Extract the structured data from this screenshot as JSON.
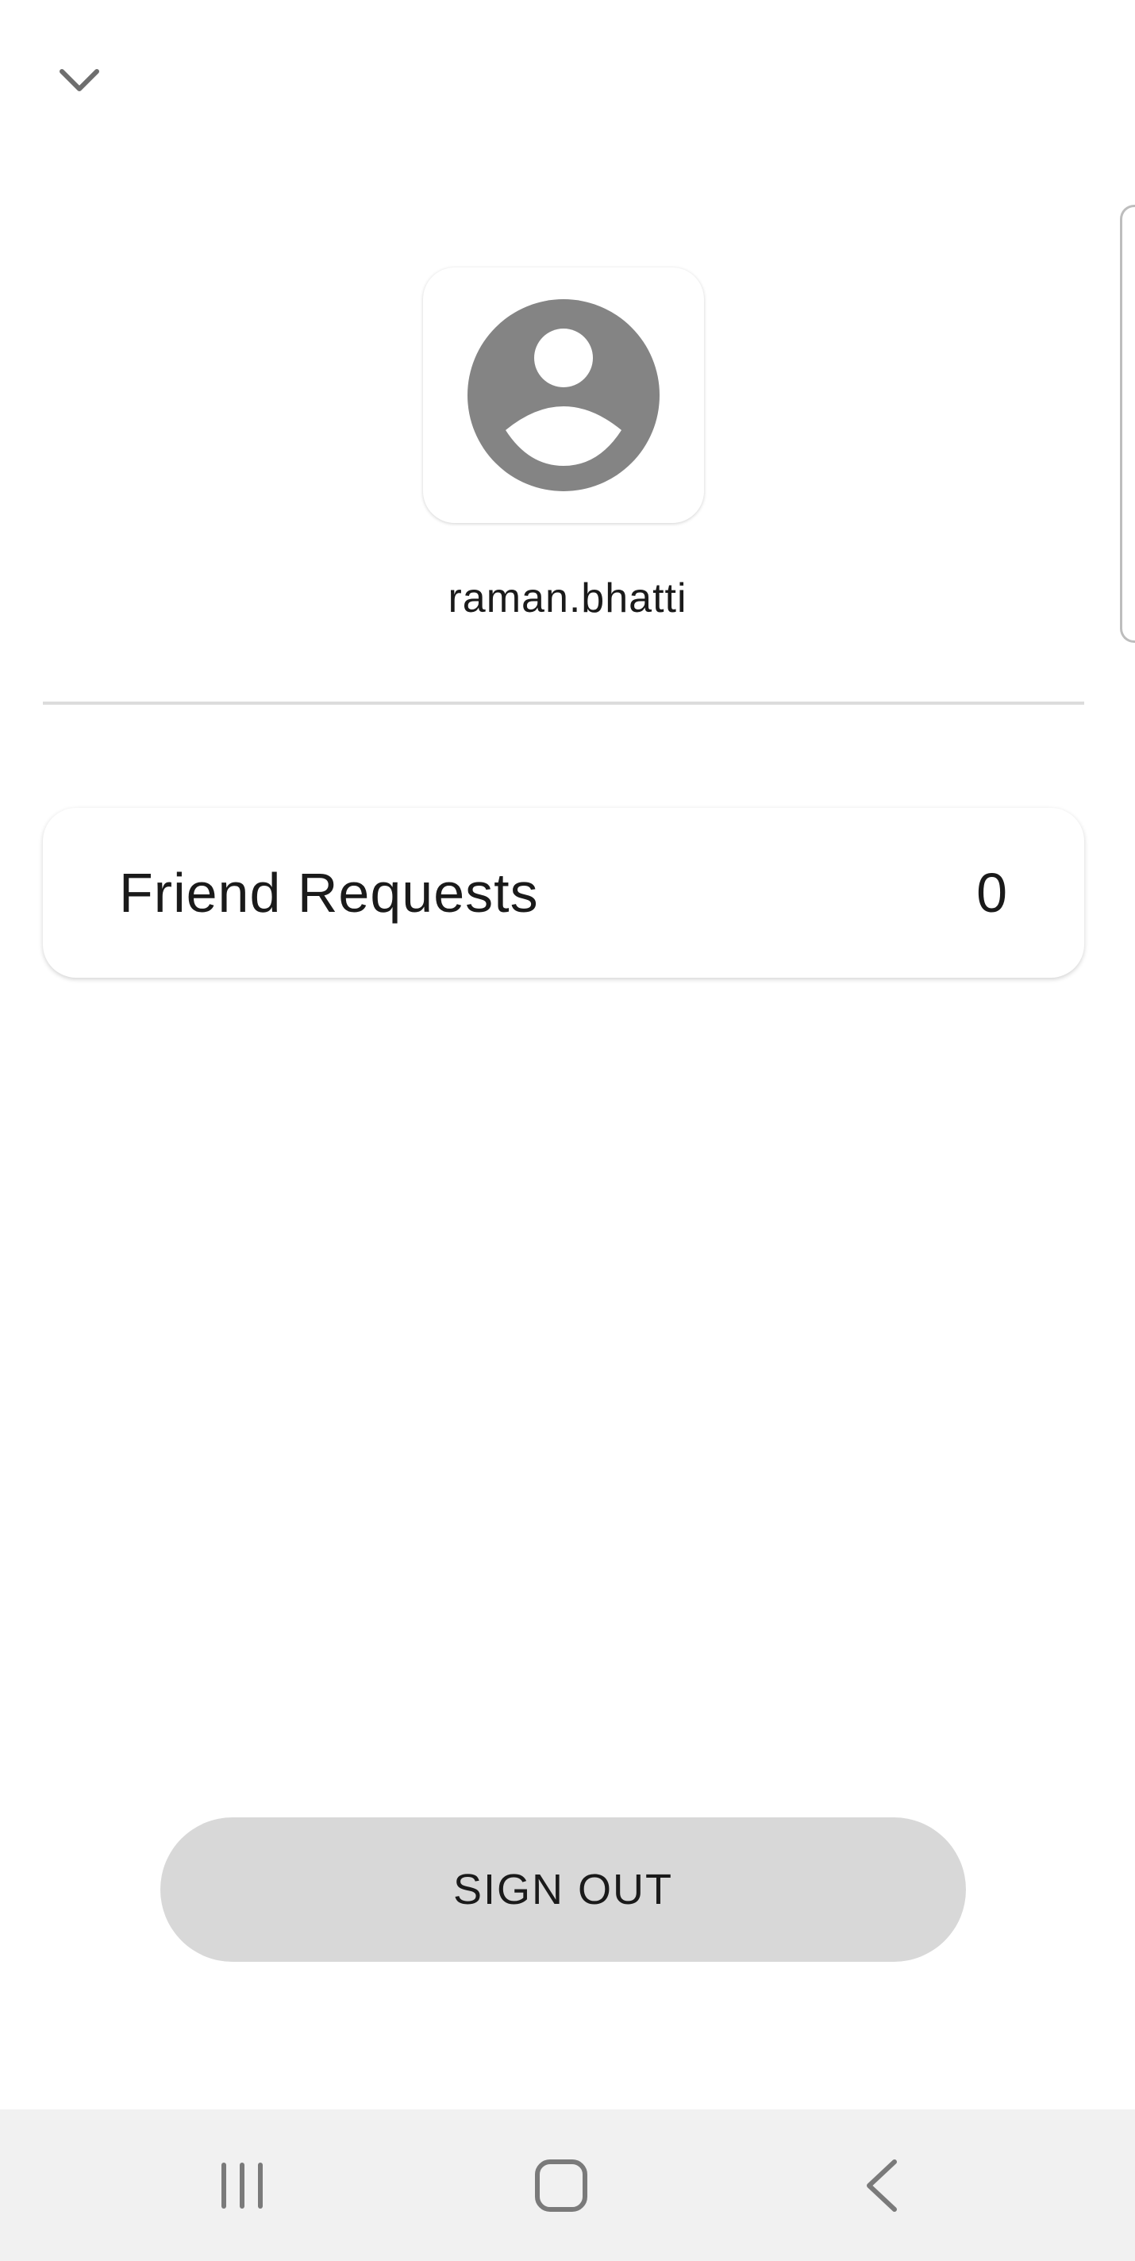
{
  "header": {
    "collapse_icon": "chevron-down-icon"
  },
  "profile": {
    "avatar_icon": "account-circle-icon",
    "username": "raman.bhatti"
  },
  "friend_requests": {
    "label": "Friend Requests",
    "count": "0"
  },
  "actions": {
    "sign_out_label": "SIGN OUT"
  },
  "system_nav": {
    "recents_icon": "recent-apps-icon",
    "home_icon": "home-icon",
    "back_icon": "back-icon"
  },
  "colors": {
    "background": "#ffffff",
    "icon_gray": "#848484",
    "sign_out_bg": "#d8d8d8",
    "nav_bar_bg": "#f1f1f1"
  }
}
